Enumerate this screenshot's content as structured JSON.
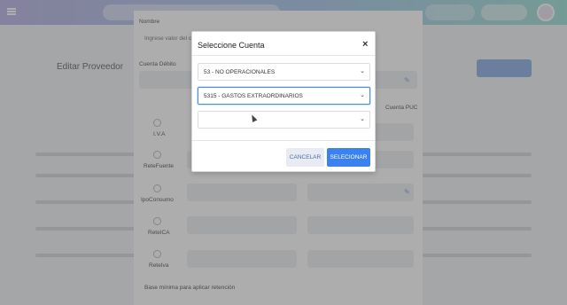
{
  "background": {
    "page_title": "Editar Proveedor"
  },
  "form": {
    "label_nombre": "Nombre",
    "placeholder_nombre": "Ingrese valor del campo",
    "label_cuenta_debito": "Cuenta Débito",
    "label_cuenta_puc": "Cuenta PUC",
    "label_iva": "I.V.A",
    "label_retefuente": "ReteFuente",
    "label_ipoconsumo": "IpoConsumo",
    "label_reteica": "ReteICA",
    "label_reteiva": "ReteIva",
    "label_base_minima": "Base mínima para aplicar retención"
  },
  "modal": {
    "title": "Seleccione Cuenta",
    "close_label": "×",
    "select_level1": "53 - NO OPERACIONALES",
    "select_level2": "5315 - GASTOS EXTRAORDINARIOS",
    "select_level3": "",
    "cancel_label": "CANCELAR",
    "select_label": "SELECIONAR"
  },
  "colors": {
    "primary": "#3b82f0",
    "focus_border": "#4a8bf0",
    "cancel_bg": "#e8ecf2"
  }
}
